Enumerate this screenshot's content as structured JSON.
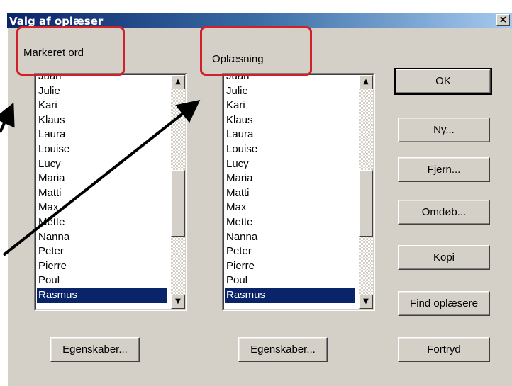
{
  "dialog": {
    "title": "Valg af oplæser",
    "close_glyph": "×"
  },
  "labels": {
    "left": "Markeret ord",
    "right": "Oplæsning"
  },
  "list_items": [
    "Juan",
    "Julie",
    "Kari",
    "Klaus",
    "Laura",
    "Louise",
    "Lucy",
    "Maria",
    "Matti",
    "Max",
    "Mette",
    "Nanna",
    "Peter",
    "Pierre",
    "Poul",
    "Rasmus"
  ],
  "selected_item": "Rasmus",
  "scroll_glyphs": {
    "up": "▲",
    "down": "▼"
  },
  "buttons": {
    "ok": "OK",
    "ny": "Ny...",
    "fjern": "Fjern...",
    "omdob": "Omdøb...",
    "kopi": "Kopi",
    "find": "Find oplæsere",
    "egenskaber_left": "Egenskaber...",
    "egenskaber_right": "Egenskaber...",
    "fortryd": "Fortryd"
  },
  "colors": {
    "highlight_red": "#d0202a",
    "selection": "#0a246a",
    "dialog_bg": "#d4d0c8"
  }
}
